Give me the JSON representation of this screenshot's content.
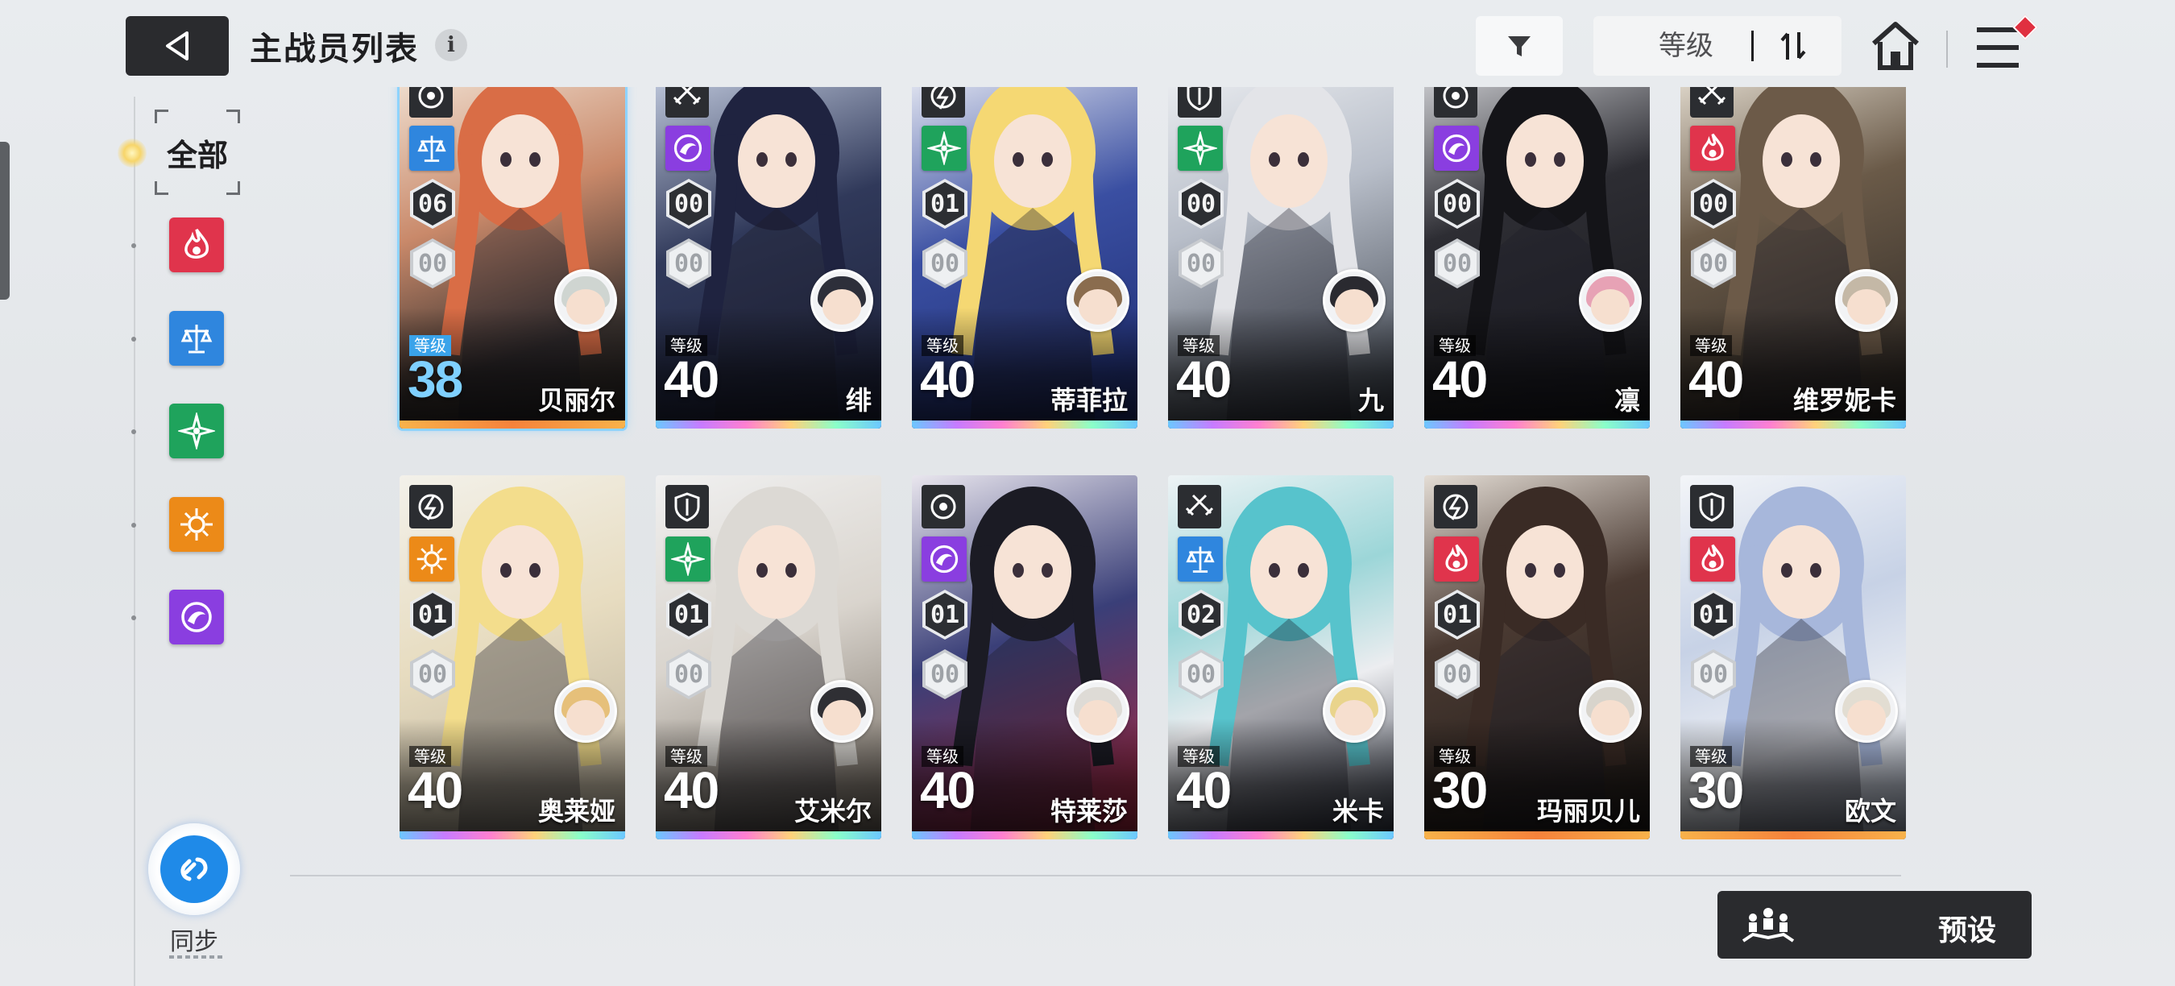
{
  "header": {
    "title": "主战员列表",
    "info_icon": "i",
    "sort_label": "等级"
  },
  "sidebar": {
    "filters": [
      {
        "label": "全部",
        "selected": true
      },
      {
        "icon": "burn-element-icon",
        "color": "#e0344c"
      },
      {
        "icon": "electric-element-icon",
        "color": "#2f86de"
      },
      {
        "icon": "wind-element-icon",
        "color": "#1fa35c"
      },
      {
        "icon": "iron-element-icon",
        "color": "#ec8a18"
      },
      {
        "icon": "water-element-icon",
        "color": "#8a3ee0"
      }
    ],
    "sync_label": "同步"
  },
  "level_tag": "等级",
  "characters": [
    {
      "name": "贝丽尔",
      "level": "38",
      "rank": "06",
      "sub": "00",
      "element": "electric",
      "selected": true
    },
    {
      "name": "绯",
      "level": "40",
      "rank": "00",
      "sub": "00",
      "element": "water"
    },
    {
      "name": "蒂菲拉",
      "level": "40",
      "rank": "01",
      "sub": "00",
      "element": "wind"
    },
    {
      "name": "九",
      "level": "40",
      "rank": "00",
      "sub": "00",
      "element": "wind"
    },
    {
      "name": "凛",
      "level": "40",
      "rank": "00",
      "sub": "00",
      "element": "water"
    },
    {
      "name": "维罗妮卡",
      "level": "40",
      "rank": "00",
      "sub": "00",
      "element": "burn"
    },
    {
      "name": "奥莱娅",
      "level": "40",
      "rank": "01",
      "sub": "00",
      "element": "iron"
    },
    {
      "name": "艾米尔",
      "level": "40",
      "rank": "01",
      "sub": "00",
      "element": "wind"
    },
    {
      "name": "特莱莎",
      "level": "40",
      "rank": "01",
      "sub": "00",
      "element": "water"
    },
    {
      "name": "米卡",
      "level": "40",
      "rank": "02",
      "sub": "00",
      "element": "electric"
    },
    {
      "name": "玛丽贝儿",
      "level": "30",
      "rank": "01",
      "sub": "00",
      "element": "burn"
    },
    {
      "name": "欧文",
      "level": "30",
      "rank": "01",
      "sub": "00",
      "element": "burn"
    }
  ],
  "footer": {
    "preset_label": "预设"
  }
}
